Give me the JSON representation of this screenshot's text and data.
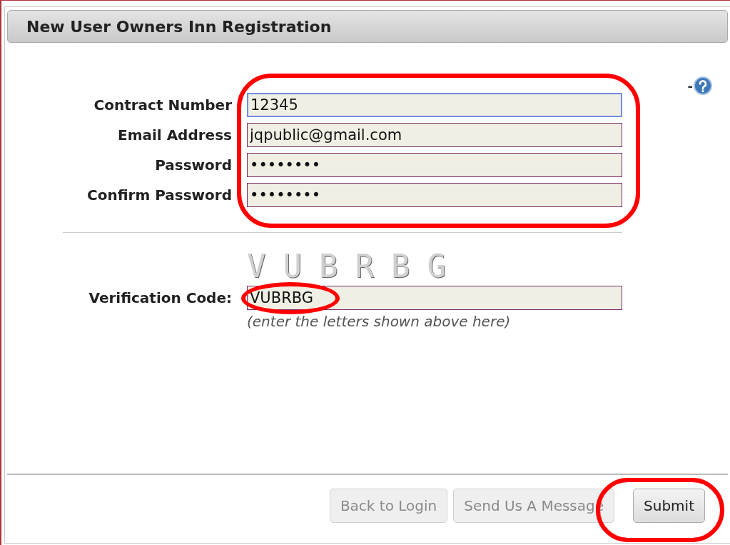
{
  "panel": {
    "title": "New User Owners Inn Registration"
  },
  "help": {
    "prefix": "-"
  },
  "fields": [
    {
      "label": "Contract Number",
      "value": "12345",
      "focused": true
    },
    {
      "label": "Email Address",
      "value": "jqpublic@gmail.com",
      "focused": false
    },
    {
      "label": "Password",
      "value": "••••••••",
      "focused": false
    },
    {
      "label": "Confirm Password",
      "value": "••••••••",
      "focused": false
    }
  ],
  "verification": {
    "captcha": "VUBRBG",
    "label": "Verification Code:",
    "value": "VUBRBG",
    "hint": "(enter the letters shown above here)"
  },
  "buttons": [
    {
      "label": "Back to Login",
      "disabled": true
    },
    {
      "label": "Send Us A Message",
      "disabled": true
    },
    {
      "label": "Submit",
      "disabled": false
    }
  ]
}
